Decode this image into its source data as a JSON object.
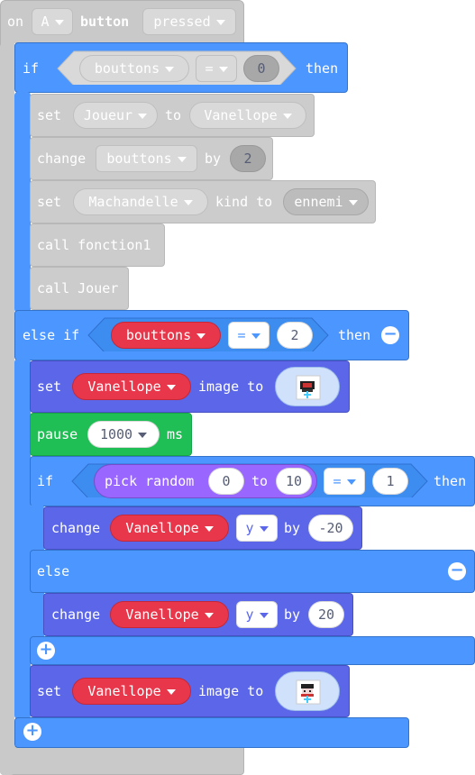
{
  "event": {
    "on": "on",
    "key": "A",
    "button": "button",
    "state": "pressed"
  },
  "if1": {
    "if": "if",
    "var": "bouttons",
    "op": "=",
    "val": "0",
    "then": "then"
  },
  "dis": [
    {
      "a": "set",
      "b": "Joueur",
      "c": "to",
      "d": "Vanellope"
    },
    {
      "a": "change",
      "b": "bouttons",
      "c": "by",
      "d": "2"
    },
    {
      "a": "set",
      "b": "Machandelle",
      "c": "kind to",
      "d": "ennemi"
    },
    {
      "a": "call fonction1"
    },
    {
      "a": "call Jouer"
    }
  ],
  "elseif": {
    "label": "else if",
    "var": "bouttons",
    "op": "=",
    "val": "2",
    "then": "then"
  },
  "set_img1": {
    "set": "set",
    "sprite": "Vanellope",
    "image_to": "image to"
  },
  "pause": {
    "label": "pause",
    "val": "1000",
    "unit": "ms"
  },
  "if2": {
    "if": "if",
    "pick": "pick random",
    "from": "0",
    "to": "to",
    "to_val": "10",
    "op": "=",
    "val": "1",
    "then": "then"
  },
  "change1": {
    "label": "change",
    "sprite": "Vanellope",
    "prop": "y",
    "by": "by",
    "val": "-20"
  },
  "else_label": "else",
  "change2": {
    "label": "change",
    "sprite": "Vanellope",
    "prop": "y",
    "by": "by",
    "val": "20"
  },
  "set_img2": {
    "set": "set",
    "sprite": "Vanellope",
    "image_to": "image to"
  },
  "colors": {
    "blue": "#4c97ff",
    "blueDark": "#3373cc",
    "darkBlue": "#5b67e8",
    "green": "#2ecc71",
    "purple": "#9966ff",
    "red": "#e8374b",
    "disabled": "#cccccc"
  }
}
